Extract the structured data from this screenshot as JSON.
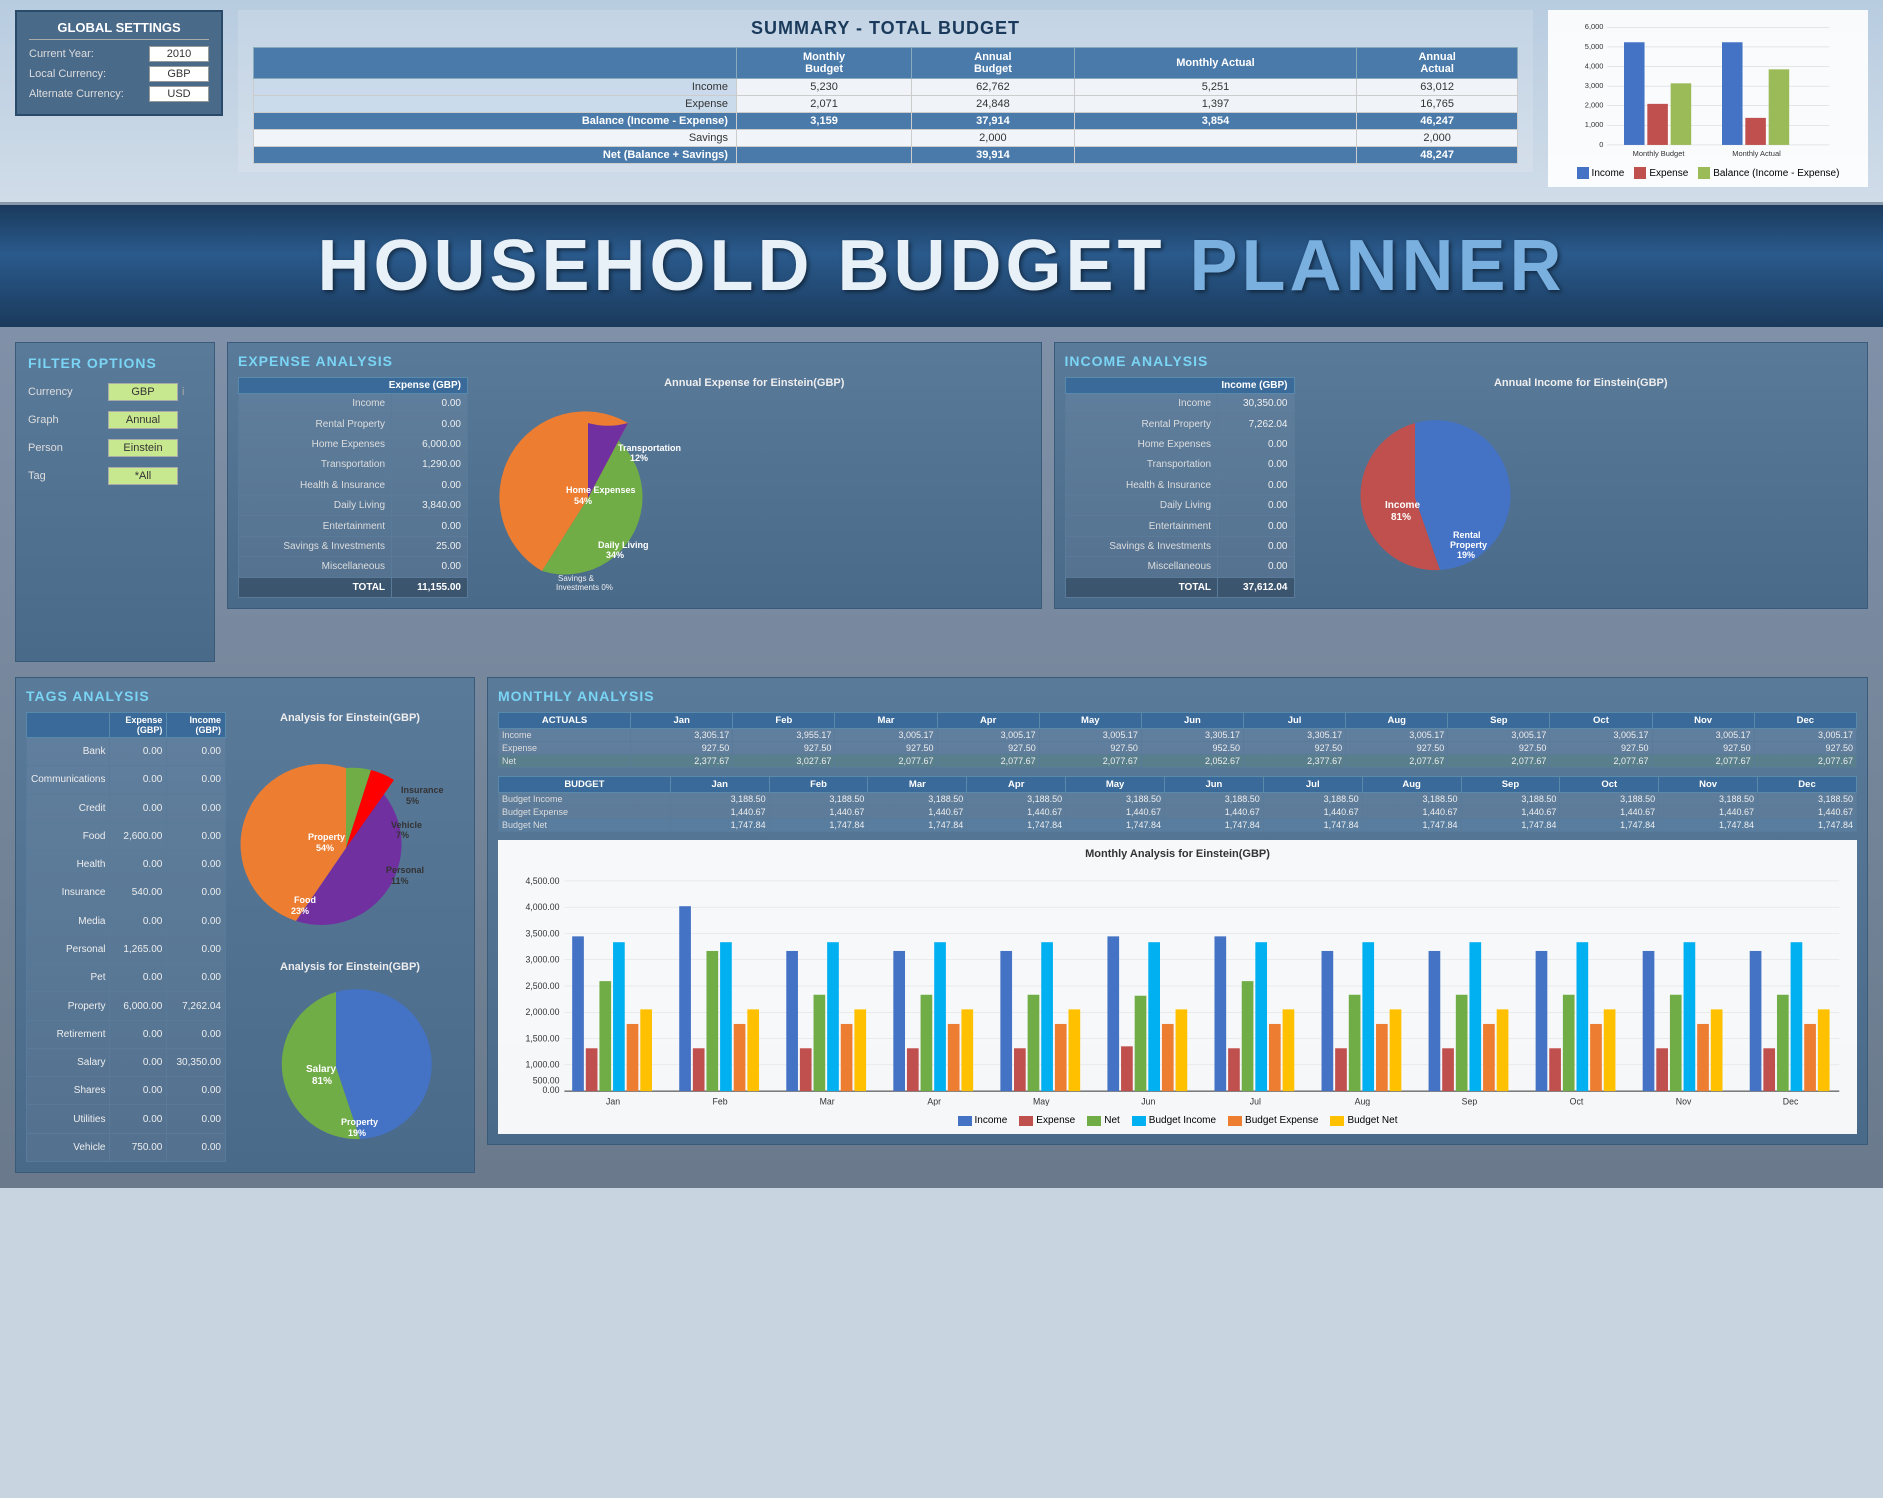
{
  "globalSettings": {
    "title": "GLOBAL SETTINGS",
    "fields": [
      {
        "label": "Current Year:",
        "value": "2010"
      },
      {
        "label": "Local Currency:",
        "value": "GBP"
      },
      {
        "label": "Alternate Currency:",
        "value": "USD"
      }
    ]
  },
  "summary": {
    "title": "SUMMARY - TOTAL BUDGET",
    "headers": [
      "",
      "Monthly Budget",
      "Annual Budget",
      "Monthly Actual",
      "Annual Actual"
    ],
    "rows": [
      {
        "label": "Income",
        "mb": "5,230",
        "ab": "62,762",
        "ma": "5,251",
        "aa": "63,012"
      },
      {
        "label": "Expense",
        "mb": "2,071",
        "ab": "24,848",
        "ma": "1,397",
        "aa": "16,765"
      }
    ],
    "balance": {
      "label": "Balance (Income - Expense)",
      "mb": "3,159",
      "ab": "37,914",
      "ma": "3,854",
      "aa": "46,247"
    },
    "savings": {
      "label": "Savings",
      "mb": "",
      "ab": "2,000",
      "ma": "",
      "aa": "2,000"
    },
    "net": {
      "label": "Net (Balance + Savings)",
      "mb": "",
      "ab": "39,914",
      "ma": "",
      "aa": "48,247"
    }
  },
  "chart": {
    "title": "",
    "yLabels": [
      "6,000",
      "5,000",
      "4,000",
      "3,000",
      "2,000",
      "1,000",
      "0"
    ],
    "xLabels": [
      "Monthly Budget",
      "Monthly Actual"
    ],
    "bars": {
      "monthlyBudget": {
        "income": 5230,
        "expense": 2071,
        "balance": 3159
      },
      "monthlyActual": {
        "income": 5251,
        "expense": 1397,
        "balance": 3854
      }
    },
    "legend": [
      "Income",
      "Expense",
      "Balance (Income - Expense)"
    ],
    "colors": {
      "income": "#4472c4",
      "expense": "#c0504d",
      "balance": "#9bbb59"
    }
  },
  "titleBanner": {
    "main": "HOUSEHOLD BUDGET",
    "planner": " PLANNER"
  },
  "filterOptions": {
    "title": "FILTER OPTIONS",
    "filters": [
      {
        "label": "Currency",
        "value": "GBP",
        "info": "i"
      },
      {
        "label": "Graph",
        "value": "Annual"
      },
      {
        "label": "Person",
        "value": "Einstein"
      },
      {
        "label": "Tag",
        "value": "*All"
      }
    ]
  },
  "expenseAnalysis": {
    "title": "EXPENSE ANALYSIS",
    "chartTitle": "Annual Expense for Einstein(GBP)",
    "rows": [
      {
        "label": "Income",
        "value": "0.00"
      },
      {
        "label": "Rental Property",
        "value": "0.00"
      },
      {
        "label": "Home Expenses",
        "value": "6,000.00"
      },
      {
        "label": "Transportation",
        "value": "1,290.00"
      },
      {
        "label": "Health & Insurance",
        "value": "0.00"
      },
      {
        "label": "Daily Living",
        "value": "3,840.00"
      },
      {
        "label": "Entertainment",
        "value": "0.00"
      },
      {
        "label": "Savings & Investments",
        "value": "25.00"
      },
      {
        "label": "Miscellaneous",
        "value": "0.00"
      },
      {
        "label": "TOTAL",
        "value": "11,155.00"
      }
    ],
    "pieSlices": [
      {
        "label": "Home Expenses",
        "pct": 54,
        "color": "#70ad47"
      },
      {
        "label": "Daily Living",
        "pct": 34,
        "color": "#ed7d31"
      },
      {
        "label": "Transportation",
        "pct": 12,
        "color": "#7030a0"
      },
      {
        "label": "Savings & Investments",
        "pct": 0,
        "color": "#c0c0c0"
      }
    ]
  },
  "incomeAnalysis": {
    "title": "INCOME ANALYSIS",
    "chartTitle": "Annual Income for Einstein(GBP)",
    "rows": [
      {
        "label": "Income",
        "value": "30,350.00"
      },
      {
        "label": "Rental Property",
        "value": "7,262.04"
      },
      {
        "label": "Home Expenses",
        "value": "0.00"
      },
      {
        "label": "Transportation",
        "value": "0.00"
      },
      {
        "label": "Health & Insurance",
        "value": "0.00"
      },
      {
        "label": "Daily Living",
        "value": "0.00"
      },
      {
        "label": "Entertainment",
        "value": "0.00"
      },
      {
        "label": "Savings & Investments",
        "value": "0.00"
      },
      {
        "label": "Miscellaneous",
        "value": "0.00"
      },
      {
        "label": "TOTAL",
        "value": "37,612.04"
      }
    ],
    "pieSlices": [
      {
        "label": "Income",
        "pct": 81,
        "color": "#4472c4"
      },
      {
        "label": "Rental Property",
        "pct": 19,
        "color": "#c0504d"
      }
    ]
  },
  "tagsAnalysis": {
    "title": "TAGS ANALYSIS",
    "chartTitle": "Analysis for Einstein(GBP)",
    "headers": [
      "",
      "Expense (GBP)",
      "Income (GBP)"
    ],
    "rows": [
      {
        "tag": "Bank",
        "expense": "0.00",
        "income": "0.00"
      },
      {
        "tag": "Communications",
        "expense": "0.00",
        "income": "0.00"
      },
      {
        "tag": "Credit",
        "expense": "0.00",
        "income": "0.00"
      },
      {
        "tag": "Food",
        "expense": "2,600.00",
        "income": "0.00"
      },
      {
        "tag": "Health",
        "expense": "0.00",
        "income": "0.00"
      },
      {
        "tag": "Insurance",
        "expense": "540.00",
        "income": "0.00"
      },
      {
        "tag": "Media",
        "expense": "0.00",
        "income": "0.00"
      },
      {
        "tag": "Personal",
        "expense": "1,265.00",
        "income": "0.00"
      },
      {
        "tag": "Pet",
        "expense": "0.00",
        "income": "0.00"
      },
      {
        "tag": "Property",
        "expense": "6,000.00",
        "income": "7,262.04"
      },
      {
        "tag": "Retirement",
        "expense": "0.00",
        "income": "0.00"
      },
      {
        "tag": "Salary",
        "expense": "0.00",
        "income": "30,350.00"
      },
      {
        "tag": "Shares",
        "expense": "0.00",
        "income": "0.00"
      },
      {
        "tag": "Utilities",
        "expense": "0.00",
        "income": "0.00"
      },
      {
        "tag": "Vehicle",
        "expense": "750.00",
        "income": "0.00"
      }
    ],
    "pieSlices": [
      {
        "label": "Property",
        "pct": 54,
        "color": "#7030a0"
      },
      {
        "label": "Food",
        "pct": 23,
        "color": "#ed7d31"
      },
      {
        "label": "Personal",
        "pct": 11,
        "color": "#c0504d"
      },
      {
        "label": "Insurance",
        "pct": 5,
        "color": "#ff0000"
      },
      {
        "label": "Vehicle",
        "pct": 7,
        "color": "#70ad47"
      }
    ],
    "pie2Slices": [
      {
        "label": "Salary",
        "pct": 81,
        "color": "#4472c4"
      },
      {
        "label": "Property",
        "pct": 19,
        "color": "#70ad47"
      }
    ],
    "pie2Title": "Analysis for Einstein(GBP)"
  },
  "monthlyAnalysis": {
    "title": "MONTHLY ANALYSIS",
    "months": [
      "Jan",
      "Feb",
      "Mar",
      "Apr",
      "May",
      "Jun",
      "Jul",
      "Aug",
      "Sep",
      "Oct",
      "Nov",
      "Dec"
    ],
    "actuals": {
      "income": [
        "3,305.17",
        "3,955.17",
        "3,005.17",
        "3,005.17",
        "3,005.17",
        "3,305.17",
        "3,305.17",
        "3,005.17",
        "3,005.17",
        "3,005.17",
        "3,005.17",
        "3,005.17"
      ],
      "expense": [
        "927.50",
        "927.50",
        "927.50",
        "927.50",
        "927.50",
        "952.50",
        "927.50",
        "927.50",
        "927.50",
        "927.50",
        "927.50",
        "927.50"
      ],
      "net": [
        "2,377.67",
        "3,027.67",
        "2,077.67",
        "2,077.67",
        "2,077.67",
        "2,052.67",
        "2,377.67",
        "2,077.67",
        "2,077.67",
        "2,077.67",
        "2,077.67",
        "2,077.67"
      ]
    },
    "budget": {
      "income": [
        "3,188.50",
        "3,188.50",
        "3,188.50",
        "3,188.50",
        "3,188.50",
        "3,188.50",
        "3,188.50",
        "3,188.50",
        "3,188.50",
        "3,188.50",
        "3,188.50",
        "3,188.50"
      ],
      "expense": [
        "1,440.67",
        "1,440.67",
        "1,440.67",
        "1,440.67",
        "1,440.67",
        "1,440.67",
        "1,440.67",
        "1,440.67",
        "1,440.67",
        "1,440.67",
        "1,440.67",
        "1,440.67"
      ],
      "net": [
        "1,747.84",
        "1,747.84",
        "1,747.84",
        "1,747.84",
        "1,747.84",
        "1,747.84",
        "1,747.84",
        "1,747.84",
        "1,747.84",
        "1,747.84",
        "1,747.84",
        "1,747.84"
      ]
    },
    "chartTitle": "Monthly Analysis for Einstein(GBP)",
    "chartColors": {
      "income": "#4472c4",
      "expense": "#c0504d",
      "net": "#70ad47",
      "budgetIncome": "#00b0f0",
      "budgetExpense": "#ed7d31",
      "budgetNet": "#ffc000"
    }
  }
}
